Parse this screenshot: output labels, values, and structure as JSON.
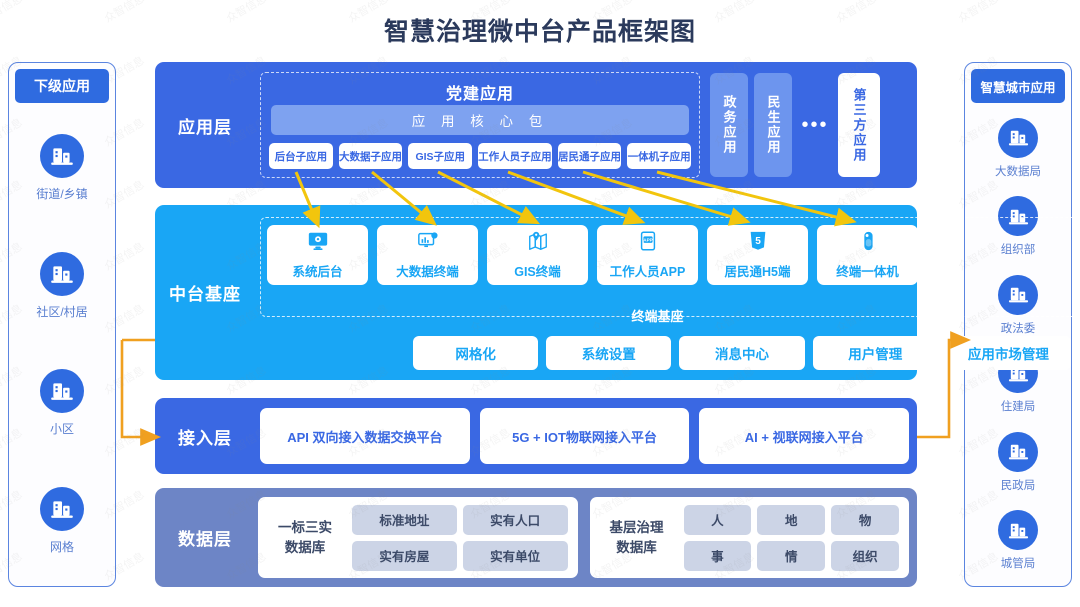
{
  "title": "智慧治理微中台产品框架图",
  "left_panel": {
    "header": "下级应用",
    "items": [
      {
        "label": "街道/乡镇",
        "icon": "building-icon"
      },
      {
        "label": "社区/村居",
        "icon": "building-icon"
      },
      {
        "label": "小区",
        "icon": "building-icon"
      },
      {
        "label": "网格",
        "icon": "building-icon"
      }
    ]
  },
  "right_panel": {
    "header": "智慧城市应用",
    "items": [
      {
        "label": "大数据局",
        "icon": "building-icon"
      },
      {
        "label": "组织部",
        "icon": "building-icon"
      },
      {
        "label": "政法委",
        "icon": "building-icon"
      },
      {
        "label": "住建局",
        "icon": "building-icon"
      },
      {
        "label": "民政局",
        "icon": "building-icon"
      },
      {
        "label": "城管局",
        "icon": "building-icon"
      }
    ]
  },
  "app_layer": {
    "label": "应用层",
    "group_title": "党建应用",
    "core_pack": "应 用 核 心 包",
    "sub_apps": [
      "后台子应用",
      "大数据子应用",
      "GIS子应用",
      "工作人员子应用",
      "居民通子应用",
      "一体机子应用"
    ],
    "vertical_boxes": [
      "政务应用",
      "民生应用"
    ],
    "ellipsis": "•••",
    "third_party": "第三方应用"
  },
  "mid_layer": {
    "label": "中台基座",
    "base_label": "终端基座",
    "terminals": [
      {
        "label": "系统后台",
        "icon": "monitor-gear-icon"
      },
      {
        "label": "大数据终端",
        "icon": "monitor-chart-icon"
      },
      {
        "label": "GIS终端",
        "icon": "map-pin-icon"
      },
      {
        "label": "工作人员APP",
        "icon": "mobile-app-icon"
      },
      {
        "label": "居民通H5端",
        "icon": "html5-icon"
      },
      {
        "label": "终端一体机",
        "icon": "kiosk-icon"
      }
    ],
    "services": [
      "网格化",
      "系统设置",
      "消息中心",
      "用户管理",
      "应用市场管理"
    ]
  },
  "access_layer": {
    "label": "接入层",
    "platforms": [
      "API 双向接入数据交换平台",
      "5G + IOT物联网接入平台",
      "AI + 视联网接入平台"
    ]
  },
  "data_layer": {
    "label": "数据层",
    "groups": [
      {
        "title": "一标三实\n数据库",
        "title_lines": [
          "一标三实",
          "数据库"
        ],
        "cells": [
          "标准地址",
          "实有人口",
          "实有房屋",
          "实有单位"
        ]
      },
      {
        "title": "基层治理\n数据库",
        "title_lines": [
          "基层治理",
          "数据库"
        ],
        "cells": [
          "人",
          "地",
          "物",
          "事",
          "情",
          "组织"
        ]
      }
    ]
  },
  "colors": {
    "app_layer": "#3a68e3",
    "mid_layer": "#19a6f5",
    "access_layer": "#3a68e3",
    "data_layer": "#6d85c6",
    "panel_accent": "#2f6be0",
    "connector": "#f0a020",
    "arrow": "#f2c50d",
    "title": "#2b3a5c"
  },
  "watermark": "众智信息"
}
